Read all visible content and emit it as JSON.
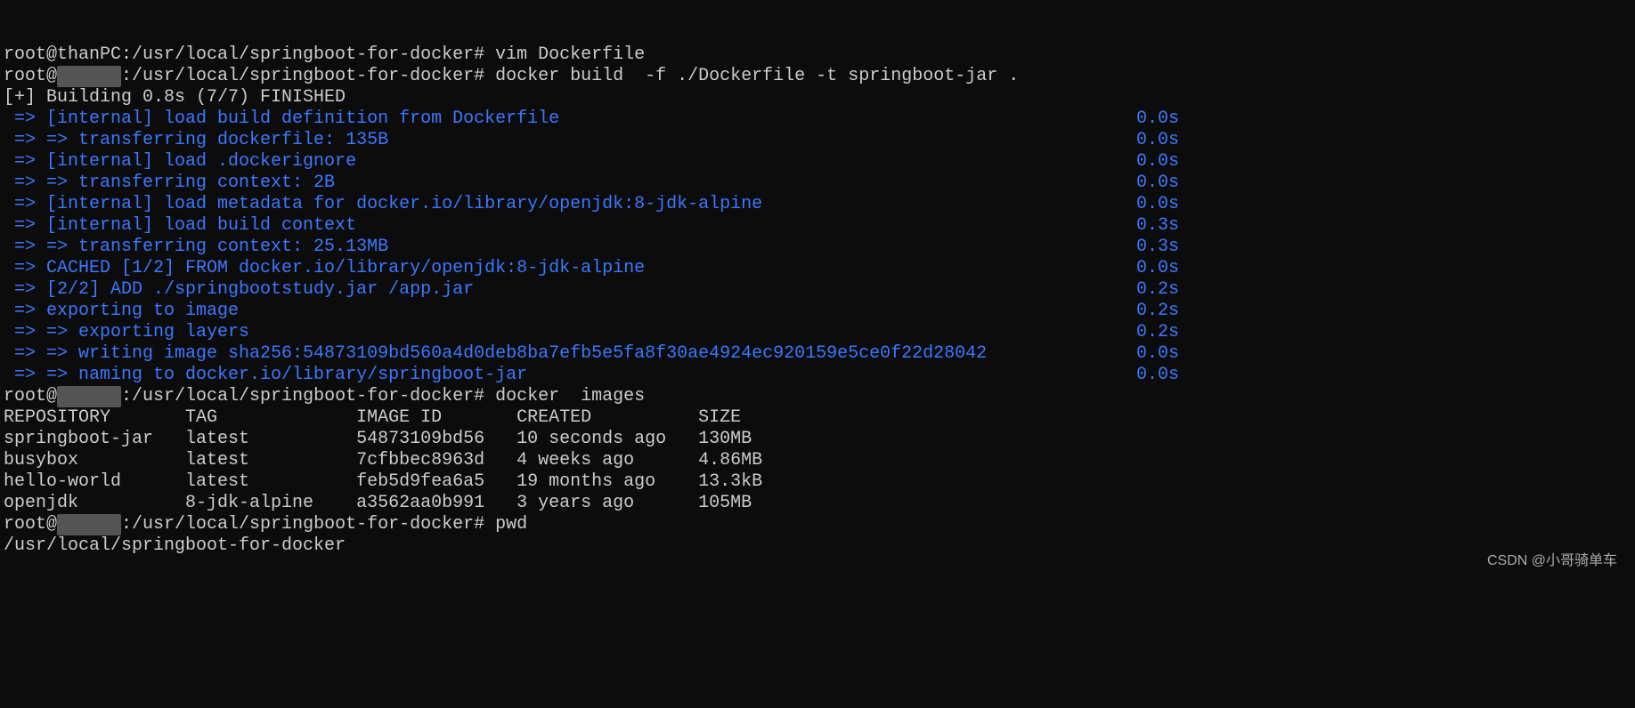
{
  "lines": {
    "top_partial": "root@thanPC:/usr/local/springboot-for-docker# vim Dockerfile"
  },
  "prompt": {
    "user": "root@",
    "redacted": "      ",
    "pathsep": ":/usr/local/springboot-for-docker#"
  },
  "commands": {
    "build": "docker build  -f ./Dockerfile -t springboot-jar .",
    "images": "docker  images",
    "pwd": "pwd"
  },
  "build": {
    "header": "[+] Building 0.8s (7/7) FINISHED",
    "steps": [
      {
        "text": " => [internal] load build definition from Dockerfile",
        "time": "0.0s"
      },
      {
        "text": " => => transferring dockerfile: 135B",
        "time": "0.0s"
      },
      {
        "text": " => [internal] load .dockerignore",
        "time": "0.0s"
      },
      {
        "text": " => => transferring context: 2B",
        "time": "0.0s"
      },
      {
        "text": " => [internal] load metadata for docker.io/library/openjdk:8-jdk-alpine",
        "time": "0.0s"
      },
      {
        "text": " => [internal] load build context",
        "time": "0.3s"
      },
      {
        "text": " => => transferring context: 25.13MB",
        "time": "0.3s"
      },
      {
        "text": " => CACHED [1/2] FROM docker.io/library/openjdk:8-jdk-alpine",
        "time": "0.0s"
      },
      {
        "text": " => [2/2] ADD ./springbootstudy.jar /app.jar",
        "time": "0.2s"
      },
      {
        "text": " => exporting to image",
        "time": "0.2s"
      },
      {
        "text": " => => exporting layers",
        "time": "0.2s"
      },
      {
        "text": " => => writing image sha256:54873109bd560a4d0deb8ba7efb5e5fa8f30ae4924ec920159e5ce0f22d28042",
        "time": "0.0s"
      },
      {
        "text": " => => naming to docker.io/library/springboot-jar",
        "time": "0.0s"
      }
    ]
  },
  "images": {
    "header": "REPOSITORY       TAG             IMAGE ID       CREATED          SIZE",
    "rows": [
      "springboot-jar   latest          54873109bd56   10 seconds ago   130MB",
      "busybox          latest          7cfbbec8963d   4 weeks ago      4.86MB",
      "hello-world      latest          feb5d9fea6a5   19 months ago    13.3kB",
      "openjdk          8-jdk-alpine    a3562aa0b991   3 years ago      105MB"
    ]
  },
  "pwd_output": "/usr/local/springboot-for-docker",
  "watermark": "CSDN @小哥骑单车"
}
